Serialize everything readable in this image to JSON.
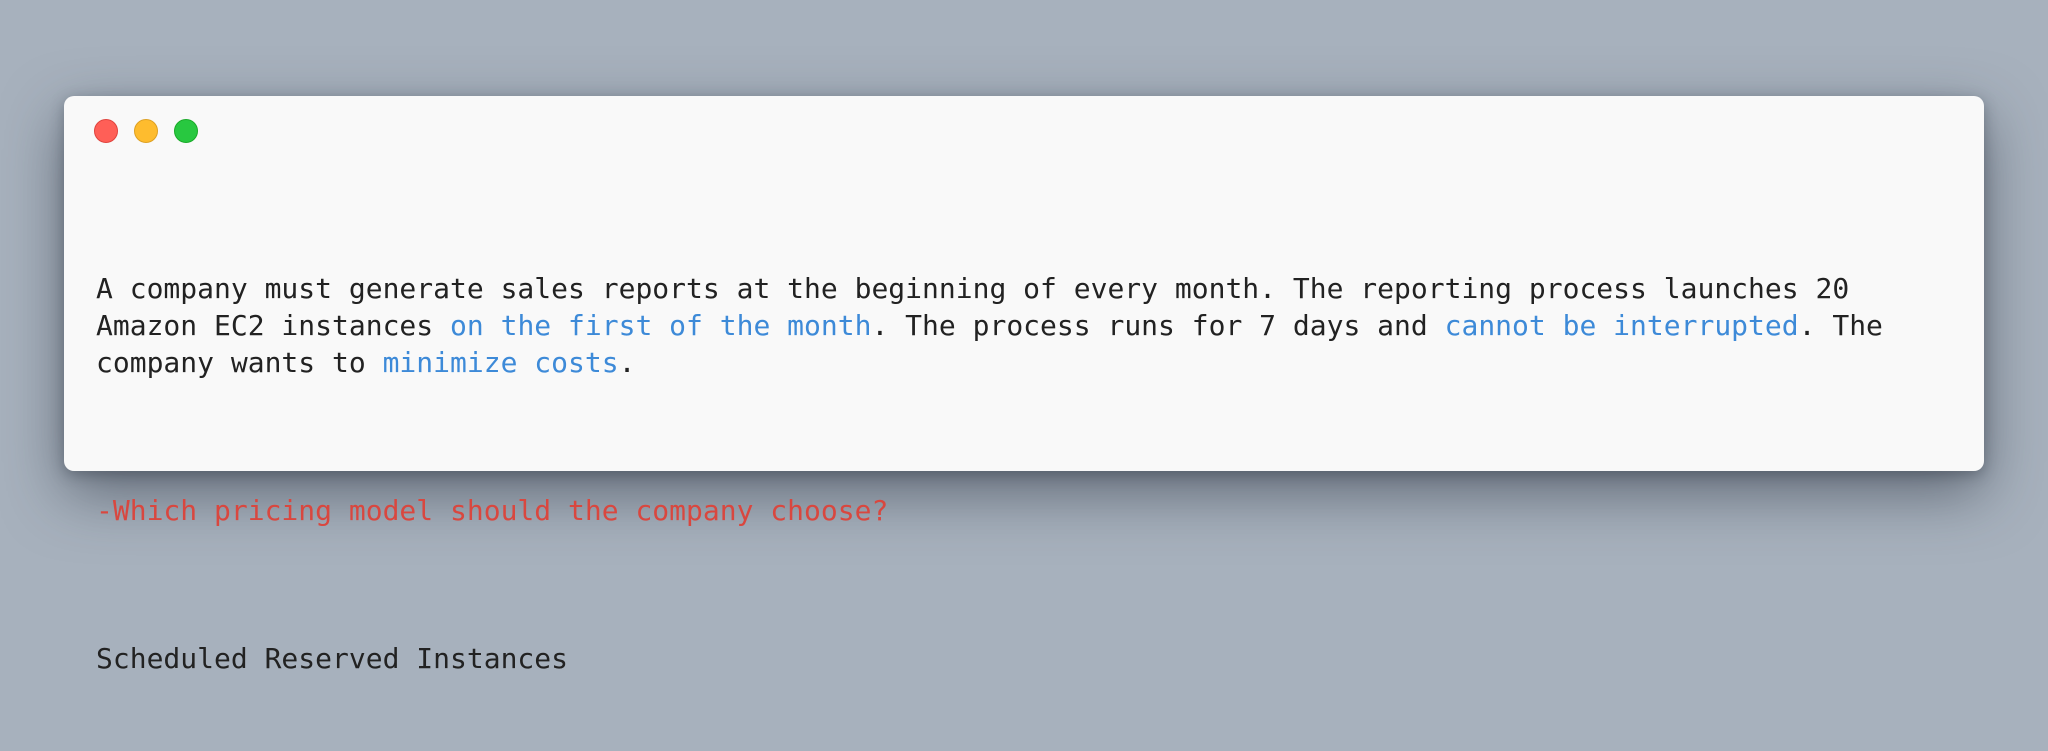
{
  "window": {
    "controls": [
      "close",
      "minimize",
      "maximize"
    ],
    "colors": {
      "close": "#ff5f57",
      "minimize": "#febc2e",
      "maximize": "#28c840",
      "highlight": "#3d8ad8",
      "question": "#d9473f"
    }
  },
  "passage": {
    "part1": "A company must generate sales reports at the beginning of every month. The reporting process launches 20\nAmazon EC2 instances ",
    "hl1": "on the first of the month",
    "part2": ". The process runs for 7 days and ",
    "hl2": "cannot be interrupted",
    "part3": ". The\ncompany wants to ",
    "hl3": "minimize costs",
    "part4": "."
  },
  "question": "-Which pricing model should the company choose?",
  "answer": "Scheduled Reserved Instances"
}
